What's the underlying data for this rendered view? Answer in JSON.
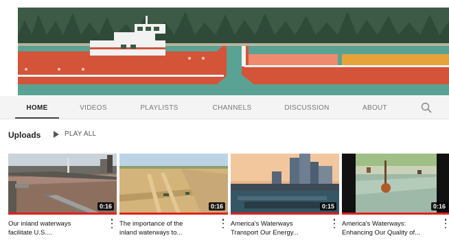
{
  "tabs": [
    {
      "label": "HOME",
      "active": true
    },
    {
      "label": "VIDEOS",
      "active": false
    },
    {
      "label": "PLAYLISTS",
      "active": false
    },
    {
      "label": "CHANNELS",
      "active": false
    },
    {
      "label": "DISCUSSION",
      "active": false
    },
    {
      "label": "ABOUT",
      "active": false
    }
  ],
  "search_icon": "search-icon",
  "section": {
    "title": "Uploads",
    "play_all": "PLAY ALL",
    "play_icon": "play-icon"
  },
  "videos": [
    {
      "title": "Our inland waterways\nfacilitate U.S....",
      "duration": "0:16"
    },
    {
      "title": "The importance of the\ninland waterways to...",
      "duration": "0:16"
    },
    {
      "title": "America's Waterways\nTransport Our Energy...",
      "duration": "0:15"
    },
    {
      "title": "America's Waterways:\nEnhancing Our Quality of...",
      "duration": "0:16"
    }
  ],
  "colors": {
    "banner_water": "#5aa394",
    "banner_forest": "#3c5a46",
    "boat_hull": "#d4543a",
    "barge_orange": "#e8a23a",
    "progress_red": "#e0201b",
    "tab_bg": "#f4f4f4"
  }
}
